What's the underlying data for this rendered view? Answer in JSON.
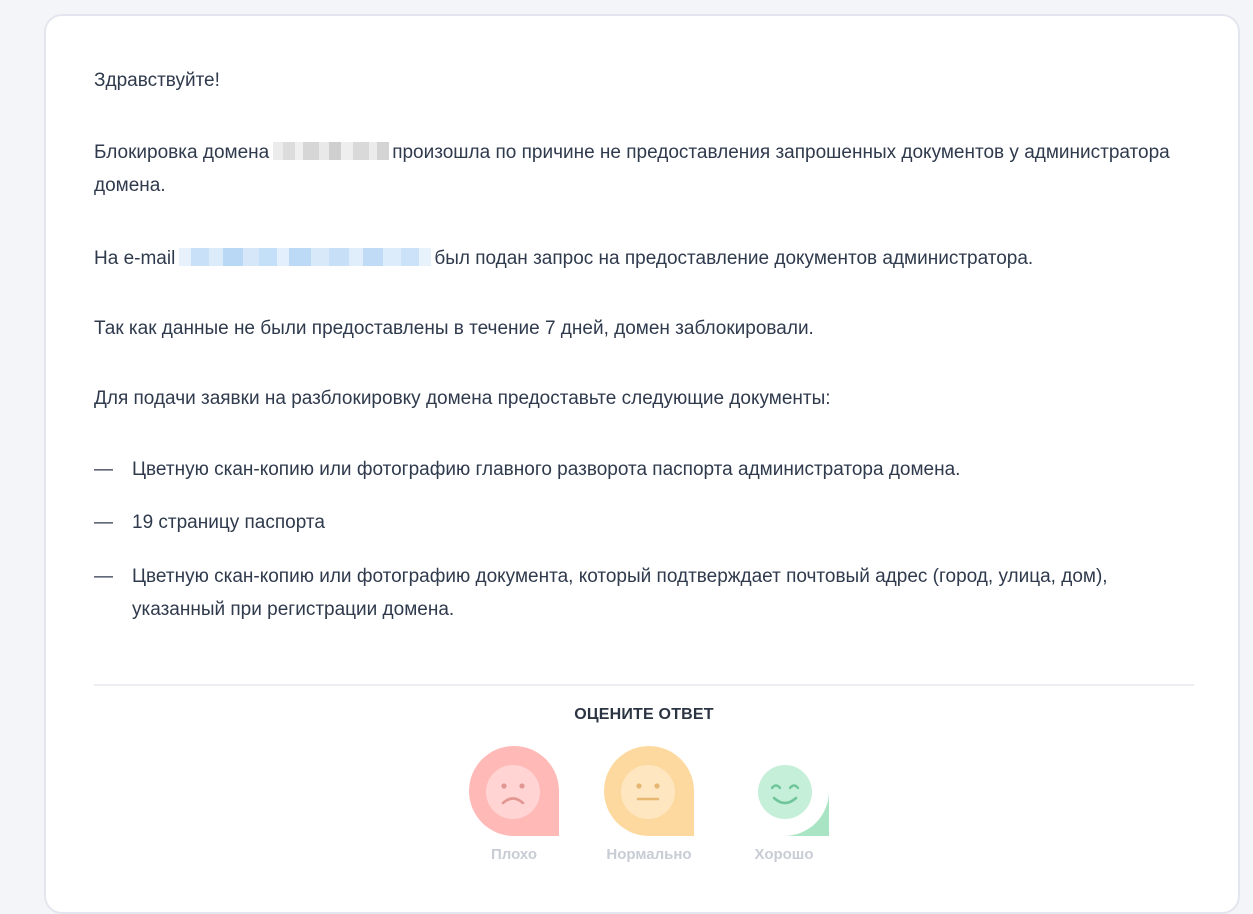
{
  "message": {
    "greeting": "Здравствуйте!",
    "block_prefix": "Блокировка домена",
    "block_suffix": "произошла по причине не предоставления запрошенных документов у администратора домена.",
    "email_prefix": "На e-mail",
    "email_suffix": "был подан запрос на предоставление документов администратора.",
    "not_provided": "Так как данные не были предоставлены в течение 7 дней, домен заблокировали.",
    "instructions": "Для подачи заявки на разблокировку домена предоставьте следующие документы:",
    "documents": [
      {
        "dash": "—",
        "text": "Цветную скан-копию или фотографию главного разворота паспорта администратора домена."
      },
      {
        "dash": "—",
        "text": "19 страницу паспорта"
      },
      {
        "dash": "—",
        "text": "Цветную скан-копию или фотографию документа, который подтверждает почтовый адрес (город, улица, дом), указанный при регистрации домена."
      }
    ]
  },
  "rating": {
    "title": "ОЦЕНИТЕ ОТВЕТ",
    "options": [
      {
        "label": "Плохо",
        "icon": "sad-face-icon",
        "color": "#ffb9b7"
      },
      {
        "label": "Нормально",
        "icon": "neutral-face-icon",
        "color": "#fdd9a0"
      },
      {
        "label": "Хорошо",
        "icon": "happy-face-icon",
        "color": "#a9e5c4"
      }
    ]
  }
}
